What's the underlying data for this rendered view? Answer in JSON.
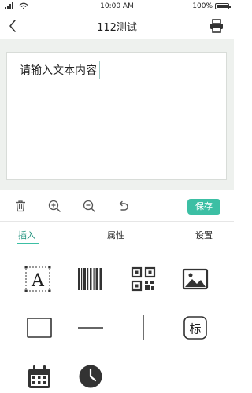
{
  "status_bar": {
    "time": "10:00 AM",
    "battery": "100%",
    "battery_level": 1.0
  },
  "header": {
    "title": "112测试"
  },
  "canvas": {
    "text_content": "请输入文本内容"
  },
  "toolbar": {
    "save_label": "保存"
  },
  "tabs": [
    {
      "label": "插入"
    },
    {
      "label": "属性"
    },
    {
      "label": "设置"
    }
  ],
  "insert_items": [
    {
      "icon": "text-icon",
      "label": "A"
    },
    {
      "icon": "barcode-icon"
    },
    {
      "icon": "qrcode-icon"
    },
    {
      "icon": "image-icon"
    },
    {
      "icon": "rectangle-icon"
    },
    {
      "icon": "horizontal-line-icon"
    },
    {
      "icon": "vertical-line-icon"
    },
    {
      "icon": "logo-icon",
      "label": "标"
    },
    {
      "icon": "calendar-icon"
    },
    {
      "icon": "clock-icon"
    }
  ],
  "colors": {
    "accent": "#3cbfa4",
    "accent_text": "#1a8f7a",
    "canvas_bg": "#eef1ee"
  }
}
